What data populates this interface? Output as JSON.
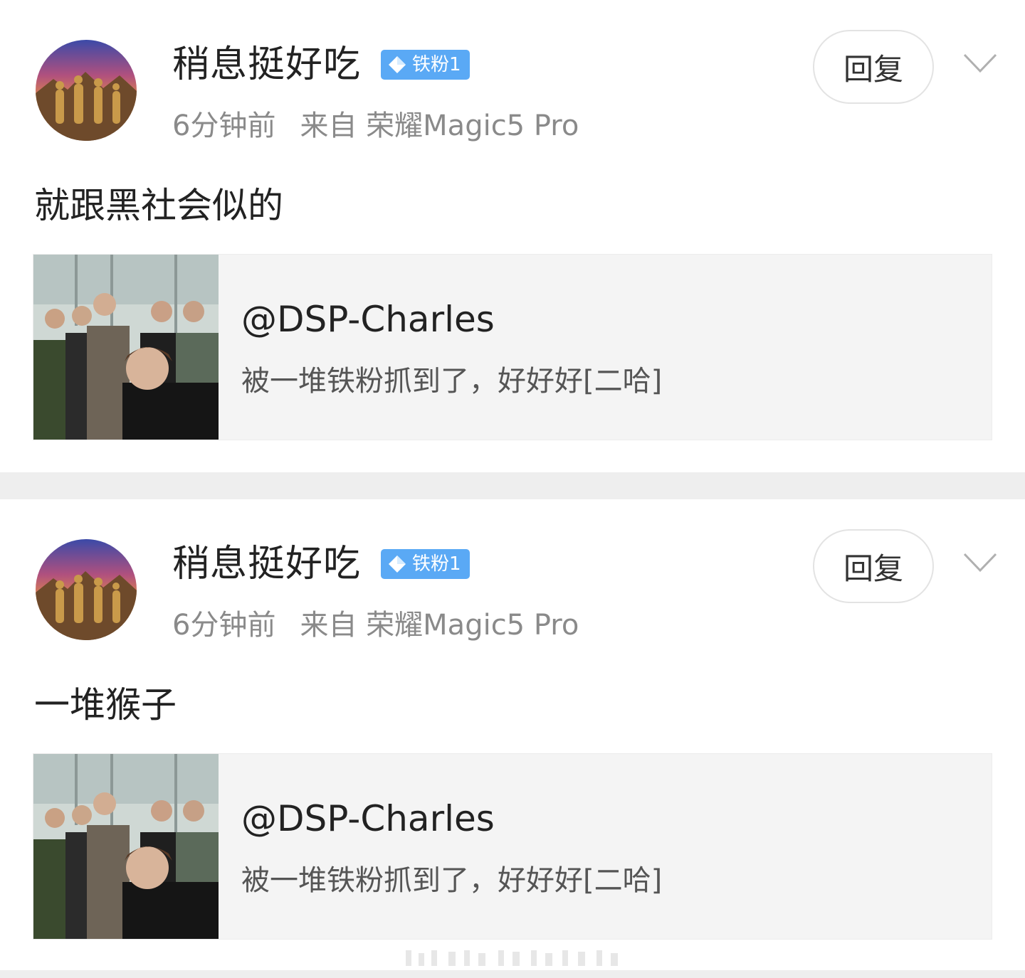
{
  "comments": [
    {
      "username": "稍息挺好吃",
      "badge": "铁粉1",
      "time": "6分钟前",
      "source": "来自 荣耀Magic5 Pro",
      "reply_label": "回复",
      "text": "就跟黑社会似的",
      "quote": {
        "author": "@DSP-Charles",
        "text": "被一堆铁粉抓到了，好好好[二哈]"
      }
    },
    {
      "username": "稍息挺好吃",
      "badge": "铁粉1",
      "time": "6分钟前",
      "source": "来自 荣耀Magic5 Pro",
      "reply_label": "回复",
      "text": "一堆猴子",
      "quote": {
        "author": "@DSP-Charles",
        "text": "被一堆铁粉抓到了，好好好[二哈]"
      }
    }
  ],
  "colors": {
    "badge": "#5aa9f5",
    "divider": "#eeeeee",
    "quote_bg": "#f4f4f4",
    "meta": "#8a8a8a"
  },
  "icons": [
    "avatar-image",
    "diamond-icon",
    "chevron-down-icon",
    "quote-thumbnail-image"
  ]
}
